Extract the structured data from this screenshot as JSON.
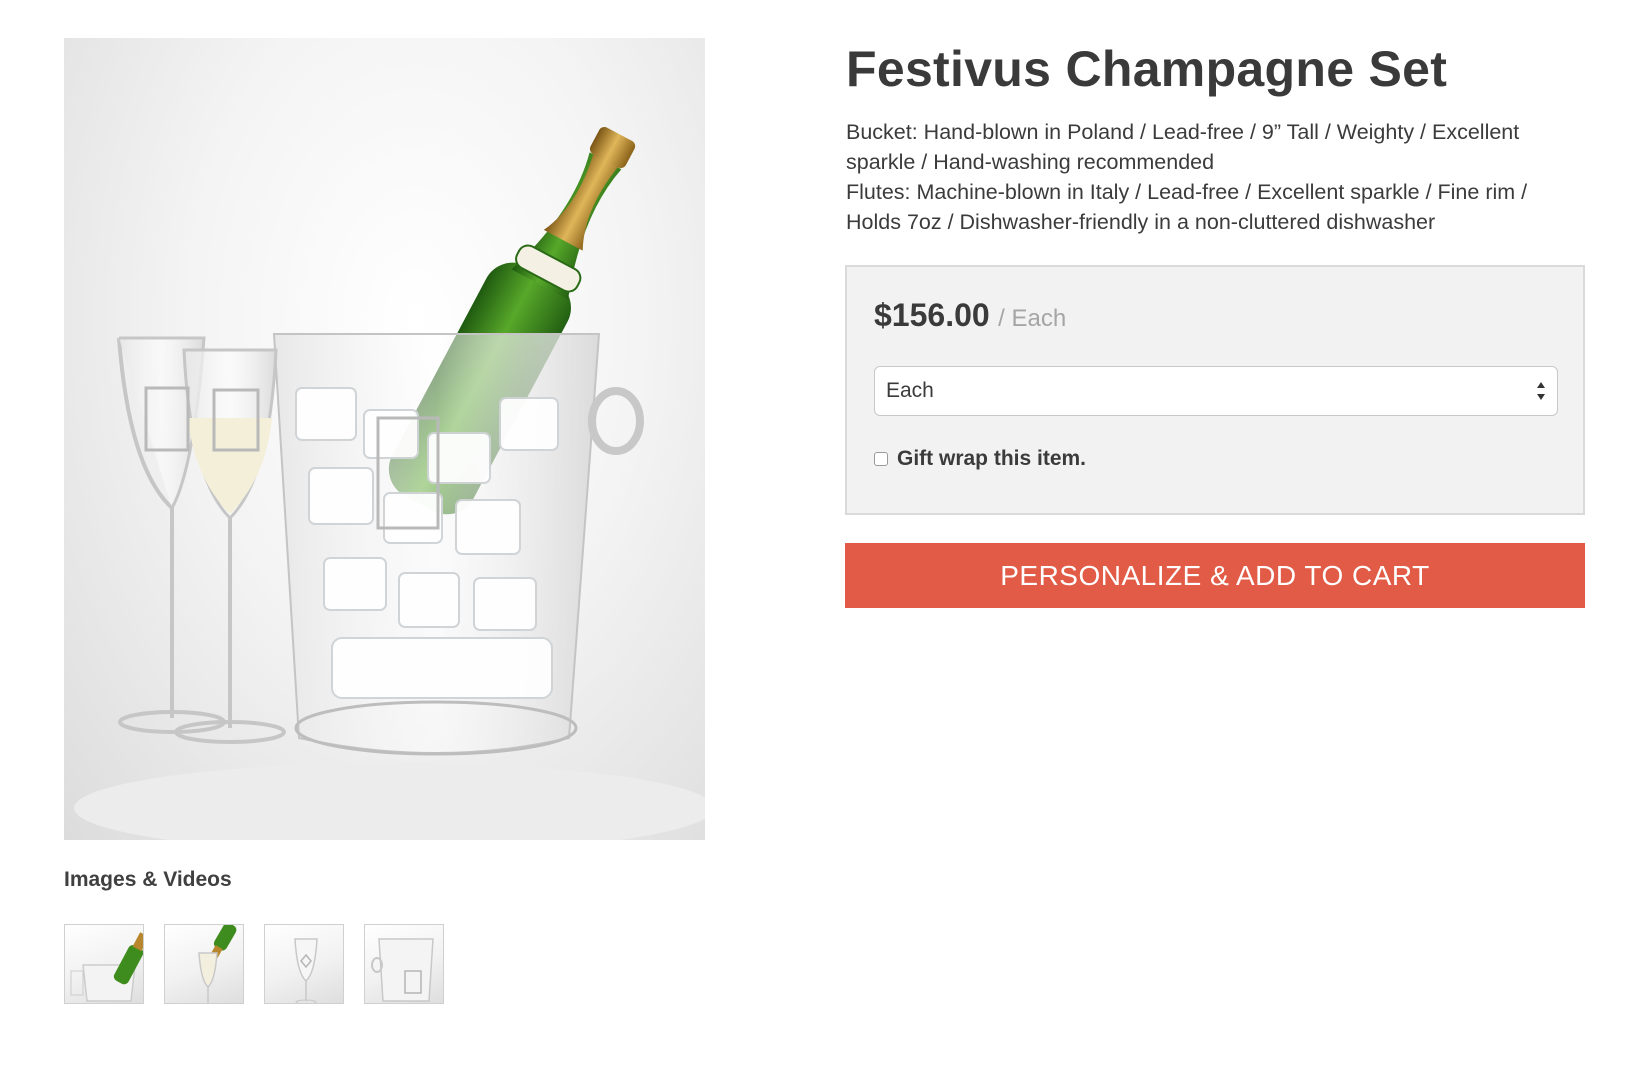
{
  "product": {
    "title": "Festivus Champagne Set",
    "description": {
      "line1": "Bucket: Hand-blown in Poland / Lead-free / 9” Tall / Weighty / Excellent sparkle / Hand-washing recommended",
      "line2": "Flutes: Machine-blown in Italy / Lead-free / Excellent sparkle / Fine rim / Holds 7oz / Dishwasher-friendly in a non-cluttered dishwasher"
    }
  },
  "purchase": {
    "price": "$156.00",
    "price_unit": "/ Each",
    "option_select": {
      "selected": "Each"
    },
    "gift_wrap": {
      "label": "Gift wrap this item.",
      "checked": false
    },
    "cart_button_label": "PERSONALIZE & ADD TO CART"
  },
  "gallery": {
    "heading": "Images & Videos",
    "main_image_icon": "champagne-bucket-photo",
    "thumbnails": [
      {
        "icon": "bucket-bottle-thumbnail"
      },
      {
        "icon": "pouring-bottle-thumbnail"
      },
      {
        "icon": "engraved-flute-thumbnail"
      },
      {
        "icon": "engraved-bucket-thumbnail"
      }
    ]
  },
  "colors": {
    "accent": "#e25b46",
    "bottle_green": "#3f8c1e",
    "foil_gold": "#b8872d",
    "price_box_bg": "#f2f2f2"
  }
}
